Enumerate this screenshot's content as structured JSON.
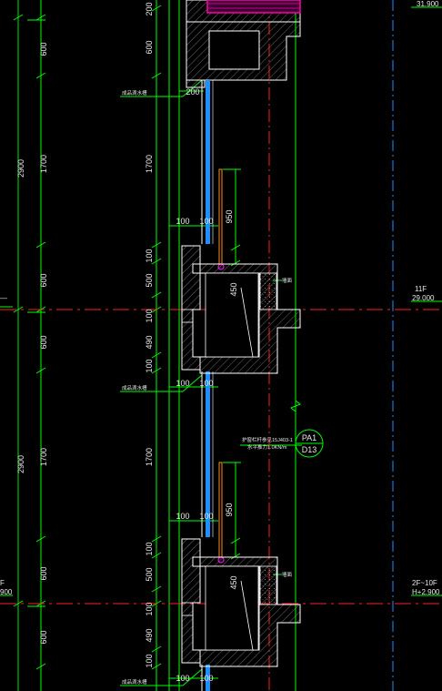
{
  "colors": {
    "background": "#000000",
    "dimension": "#00ff00",
    "concrete": "#ffffff",
    "glass": "#1e8fff",
    "axis": "#ff2020",
    "railing": "#ff8c1a",
    "hatch": "#9a9a9a",
    "level_line": "#00bcd4"
  },
  "overall_dims": {
    "top_floor": "2900",
    "bottom_floor": "2900"
  },
  "floor_split_dims": {
    "top_upper": "600",
    "top_mid": "1700",
    "top_lower": "600",
    "bottom_upper": "600",
    "bottom_mid": "1700",
    "bottom_lower": "600",
    "below_lower": "600"
  },
  "detail_dims": {
    "top_200": "200",
    "top_600": "600",
    "top_1700": "1700",
    "a_100": "100",
    "a_500": "500",
    "a_100b": "100",
    "a_490": "490",
    "a_100c": "100",
    "b_1700": "1700",
    "b_100": "100",
    "b_500": "500",
    "b_100b": "100",
    "b_490": "490",
    "b_100c": "100"
  },
  "horizontal_dims": {
    "h_200": "200",
    "h_100_left_a": "100",
    "h_100_right_a": "100",
    "h_100_left_b": "100",
    "h_100_right_b": "100",
    "h_100_left_c": "100",
    "h_100_right_c": "100",
    "h_100_left_d": "100",
    "h_100_right_d": "100"
  },
  "railing_dims": {
    "upper_950": "950",
    "upper_450": "450",
    "lower_950": "950",
    "lower_450": "450"
  },
  "labels": {
    "waterproof_1": "成品滴水槽",
    "waterproof_2": "成品滴水槽",
    "waterproof_3": "成品滴水槽",
    "side_1": "墙面",
    "side_2": "墙面",
    "railing_note_1": "护窗栏杆参见15J403-1",
    "railing_note_2": "水平推力1.0KN/m"
  },
  "detail_tag": {
    "top": "PA1",
    "bottom": "D13"
  },
  "levels": {
    "roof_value": "31.900",
    "eleven_floor": "11F",
    "eleven_value": "29.000",
    "range_floor": "2F~10F",
    "range_value": "H+2.900"
  },
  "left_edge_fragments": {
    "upper": "—",
    "lower": "F",
    "lower_value": "900"
  }
}
